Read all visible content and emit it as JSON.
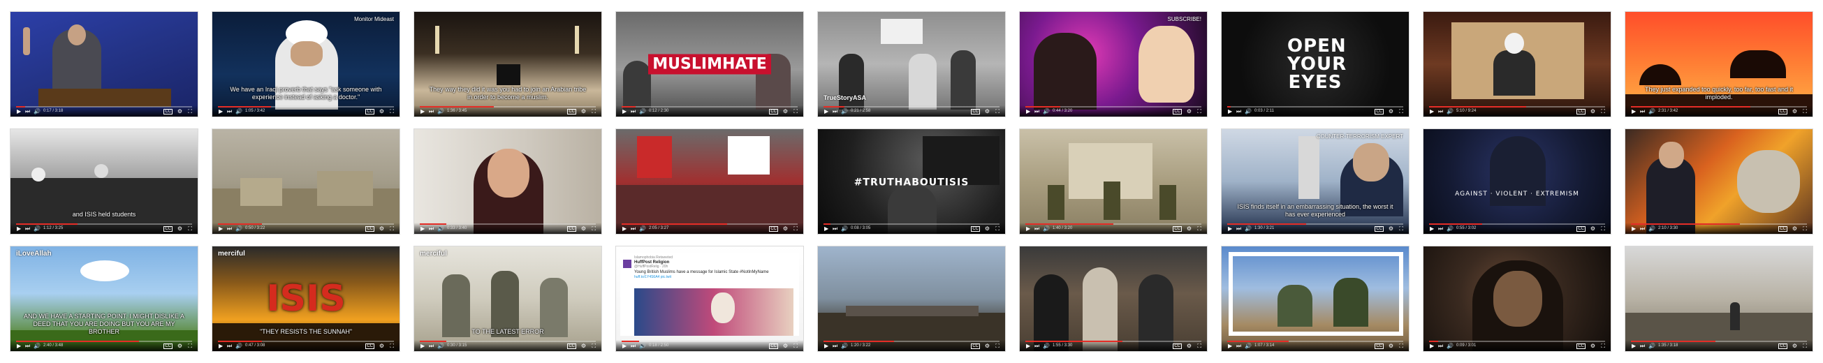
{
  "tiles": [
    {
      "id": "r1c1",
      "bg": "linear-gradient(160deg,#2c3fa8 0%,#243488 45%,#1a2466 100%)",
      "caption": "",
      "overlay": "",
      "corner": "",
      "brand": "",
      "badge": "",
      "progress": 0.05,
      "time": "0:17 / 3:18"
    },
    {
      "id": "r1c2",
      "bg": "linear-gradient(180deg,#0b1d3a 0%,#12315c 60%,#0a1a33 100%)",
      "caption": "We have an Iraqi proverb that says \"ask someone with experience instead of asking a doctor.\"",
      "overlay": "",
      "corner": "Monitor Mideast",
      "brand": "",
      "badge": "",
      "progress": 0.3,
      "time": "1:05 / 3:42"
    },
    {
      "id": "r1c3",
      "bg": "linear-gradient(180deg,#1a1410 0%,#3b2f22 40%,#c9b79a 75%,#8a7a60 100%)",
      "caption": "They way they did it was you had to join an Arabian tribe in order to become a muslim.",
      "overlay": "",
      "corner": "",
      "brand": "",
      "badge": "",
      "progress": 0.42,
      "time": "1:36 / 3:45"
    },
    {
      "id": "r1c4",
      "bg": "linear-gradient(180deg,#6a6a6a 0%,#9a9a9a 55%,#4c4c4c 100%)",
      "caption": "",
      "overlay": "MUSLIMHATE",
      "corner": "",
      "brand": "",
      "badge": "",
      "progress": 0.08,
      "time": "0:12 / 2:30"
    },
    {
      "id": "r1c5",
      "bg": "linear-gradient(180deg,#8f8f8f 0%,#b5b5b5 50%,#6e6e6e 100%)",
      "caption": "",
      "overlay": "",
      "corner": "",
      "brand": "",
      "badge": "TrueStoryASA",
      "progress": 0.12,
      "time": "0:21 / 2:58"
    },
    {
      "id": "r1c6",
      "bg": "radial-gradient(circle at 35% 40%,#e23bb5 0%,#7a1a8f 40%,#1a0a1f 100%)",
      "caption": "",
      "overlay": "",
      "corner": "SUBSCRIBE!",
      "brand": "",
      "badge": "",
      "progress": 0.2,
      "time": "0:44 / 3:20"
    },
    {
      "id": "r1c7",
      "bg": "radial-gradient(circle at 50% 50%,#2a2a2a 0%,#0d0d0d 70%)",
      "caption": "",
      "overlay": "OPEN YOUR EYES",
      "corner": "",
      "brand": "",
      "badge": "",
      "progress": 0.02,
      "time": "0:03 / 2:11"
    },
    {
      "id": "r1c8",
      "bg": "linear-gradient(180deg,#3a1a10 0%,#6e3a22 50%,#2a140c 100%)",
      "caption": "",
      "overlay": "",
      "corner": "",
      "brand": "",
      "badge": "",
      "progress": 0.55,
      "time": "5:10 / 9:24"
    },
    {
      "id": "r1c9",
      "bg": "linear-gradient(180deg,#ff4e2a 0%,#ff7a33 45%,#ffb347 100%)",
      "caption": "They just expanded too quickly, too far, too fast and it imploded.",
      "overlay": "",
      "corner": "",
      "brand": "",
      "badge": "",
      "progress": 0.68,
      "time": "2:31 / 3:42"
    },
    {
      "id": "r2c1",
      "bg": "linear-gradient(180deg,#e6e6e6 0%,#9d9d9d 50%,#4a4a4a 100%)",
      "caption": "and ISIS held students",
      "overlay": "",
      "corner": "",
      "brand": "",
      "badge": "",
      "progress": 0.35,
      "time": "1:12 / 3:25"
    },
    {
      "id": "r2c2",
      "bg": "linear-gradient(180deg,#b9b3a5 0%,#a39c89 50%,#7e7660 100%)",
      "caption": "",
      "overlay": "",
      "corner": "",
      "brand": "",
      "badge": "",
      "progress": 0.25,
      "time": "0:50 / 3:22"
    },
    {
      "id": "r2c3",
      "bg": "linear-gradient(90deg,#e9e6e0 0%,#cfc9bf 60%,#b9b1a3 100%)",
      "caption": "",
      "overlay": "",
      "corner": "",
      "brand": "",
      "badge": "",
      "progress": 0.15,
      "time": "0:33 / 3:40"
    },
    {
      "id": "r2c4",
      "bg": "linear-gradient(180deg,#6b6b6b 0%,#a03030 50%,#3a2020 100%)",
      "caption": "",
      "overlay": "",
      "corner": "",
      "brand": "",
      "badge": "",
      "progress": 0.6,
      "time": "2:05 / 3:27"
    },
    {
      "id": "r2c5",
      "bg": "radial-gradient(circle at 60% 30%,#5a5a5a 0%,#1f1f1f 60%,#0a0a0a 100%)",
      "caption": "",
      "overlay": "#TRUTHABOUTISIS",
      "corner": "",
      "brand": "",
      "badge": "",
      "progress": 0.04,
      "time": "0:08 / 3:05"
    },
    {
      "id": "r2c6",
      "bg": "linear-gradient(180deg,#c9c0a8 0%,#a99e80 50%,#8a7f63 100%)",
      "caption": "",
      "overlay": "",
      "corner": "",
      "brand": "",
      "badge": "",
      "progress": 0.5,
      "time": "1:40 / 3:20"
    },
    {
      "id": "r2c7",
      "bg": "linear-gradient(180deg,#cfd8e4 0%,#9fb2c8 50%,#1e2c48 100%)",
      "caption": "ISIS finds itself in an embarrassing situation, the worst it has ever experienced",
      "overlay": "",
      "corner": "COUNTER-TERRORISM EXPERT",
      "brand": "",
      "badge": "",
      "progress": 0.45,
      "time": "1:30 / 3:21"
    },
    {
      "id": "r2c8",
      "bg": "radial-gradient(circle at 50% 40%,#2a3466 0%,#141a33 60%,#0a0d1a 100%)",
      "caption": "",
      "overlay": "AGAINST · VIOLENT · EXTREMISM",
      "corner": "",
      "brand": "",
      "badge": "",
      "progress": 0.3,
      "time": "0:55 / 3:02"
    },
    {
      "id": "r2c9",
      "bg": "linear-gradient(135deg,#3b2a22 0%,#d9621f 40%,#f0a22a 60%,#5a3320 100%)",
      "caption": "",
      "overlay": "",
      "corner": "",
      "brand": "",
      "badge": "",
      "progress": 0.62,
      "time": "2:10 / 3:30"
    },
    {
      "id": "r3c1",
      "bg": "linear-gradient(180deg,#7fb2e4 0%,#a8cff0 45%,#5a8a3a 85%,#4a7a2a 100%)",
      "caption": "AND WE HAVE A STARTING POINT. I MIGHT DISLIKE A DEED THAT YOU ARE DOING BUT YOU ARE MY BROTHER",
      "overlay": "",
      "corner": "",
      "brand": "iLoveAllah",
      "badge": "",
      "progress": 0.7,
      "time": "2:40 / 3:48"
    },
    {
      "id": "r3c2",
      "bg": "linear-gradient(180deg,#2a2a2a 0%,#8a5a1a 35%,#f0a020 70%,#3a2a10 100%)",
      "caption": "\"THEY RESISTS THE SUNNAH\"",
      "overlay": "ISIS",
      "corner": "",
      "brand": "merciful",
      "badge": "",
      "progress": 0.25,
      "time": "0:47 / 3:08"
    },
    {
      "id": "r3c3",
      "bg": "linear-gradient(180deg,#e6e4dc 0%,#cfcbbd 50%,#a6a08c 100%)",
      "caption": "TO THE LATEST ERROR",
      "overlay": "",
      "corner": "",
      "brand": "merciful",
      "badge": "",
      "progress": 0.15,
      "time": "0:30 / 3:15"
    },
    {
      "id": "r3c4",
      "bg": "linear-gradient(180deg,#ffffff 0%,#f2f2f2 100%)",
      "caption": "",
      "overlay": "",
      "corner": "",
      "brand": "",
      "badge": "",
      "progress": 0.1,
      "time": "0:18 / 2:50",
      "tweet": {
        "retweet": "Islamophobia Retweeted",
        "name": "HuffPost Religion",
        "handle": "@HuffPostRelig · 20h",
        "text": "Young British Muslims have a message for Islamic State #NotInMyName",
        "link": "huff.to/1Y4S6A4 pic.twit"
      }
    },
    {
      "id": "r3c5",
      "bg": "linear-gradient(180deg,#9fb4cc 0%,#7f8f9e 50%,#3f3a30 80%,#2a241c 100%)",
      "caption": "",
      "overlay": "",
      "corner": "",
      "brand": "",
      "badge": "",
      "progress": 0.4,
      "time": "1:20 / 3:22"
    },
    {
      "id": "r3c6",
      "bg": "linear-gradient(180deg,#3a3a3a 0%,#6a5a4a 45%,#4a3f33 100%)",
      "caption": "",
      "overlay": "",
      "corner": "",
      "brand": "",
      "badge": "",
      "progress": 0.55,
      "time": "1:55 / 3:30"
    },
    {
      "id": "r3c7",
      "bg": "linear-gradient(180deg,#5a8acc 0%,#9fbde0 40%,#a58a63 75%,#6e5a3f 100%)",
      "caption": "",
      "overlay": "",
      "corner": "",
      "brand": "",
      "badge": "",
      "progress": 0.35,
      "time": "1:07 / 3:14"
    },
    {
      "id": "r3c8",
      "bg": "radial-gradient(circle at 45% 45%,#6a4a36 0%,#3a2a20 40%,#120d0a 100%)",
      "caption": "",
      "overlay": "",
      "corner": "",
      "brand": "",
      "badge": "",
      "progress": 0.05,
      "time": "0:09 / 3:01"
    },
    {
      "id": "r3c9",
      "bg": "linear-gradient(180deg,#d8d8d8 0%,#b8b2a5 50%,#7a7465 100%)",
      "caption": "",
      "overlay": "",
      "corner": "",
      "brand": "",
      "badge": "",
      "progress": 0.48,
      "time": "1:35 / 3:18"
    }
  ],
  "icons": {
    "play": "▶",
    "next": "⏭",
    "volume": "🔊",
    "settings": "⚙",
    "fullscreen": "⛶",
    "cc": "CC"
  },
  "accent": "#e52d27"
}
